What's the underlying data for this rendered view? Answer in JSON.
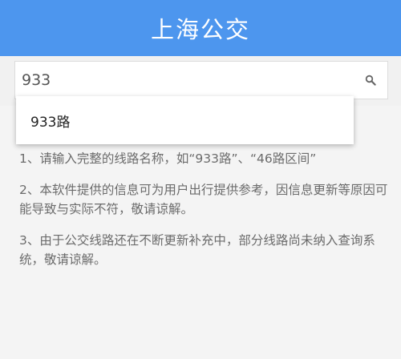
{
  "header": {
    "title": "上海公交"
  },
  "search": {
    "value": "933",
    "placeholder": "",
    "button_icon": "search-icon"
  },
  "suggestions": [
    {
      "label": "933路"
    }
  ],
  "notes": [
    "1、请输入完整的线路名称，如“933路”、“46路区间”",
    "2、本软件提供的信息可为用户出行提供参考，因信息更新等原因可能导致与实际不符，敬请谅解。",
    "3、由于公交线路还在不断更新补充中，部分线路尚未纳入查询系统，敬请谅解。"
  ],
  "colors": {
    "header_bg": "#4d96ee",
    "page_bg": "#f4f4f4",
    "note_text": "#6b6b6b"
  }
}
